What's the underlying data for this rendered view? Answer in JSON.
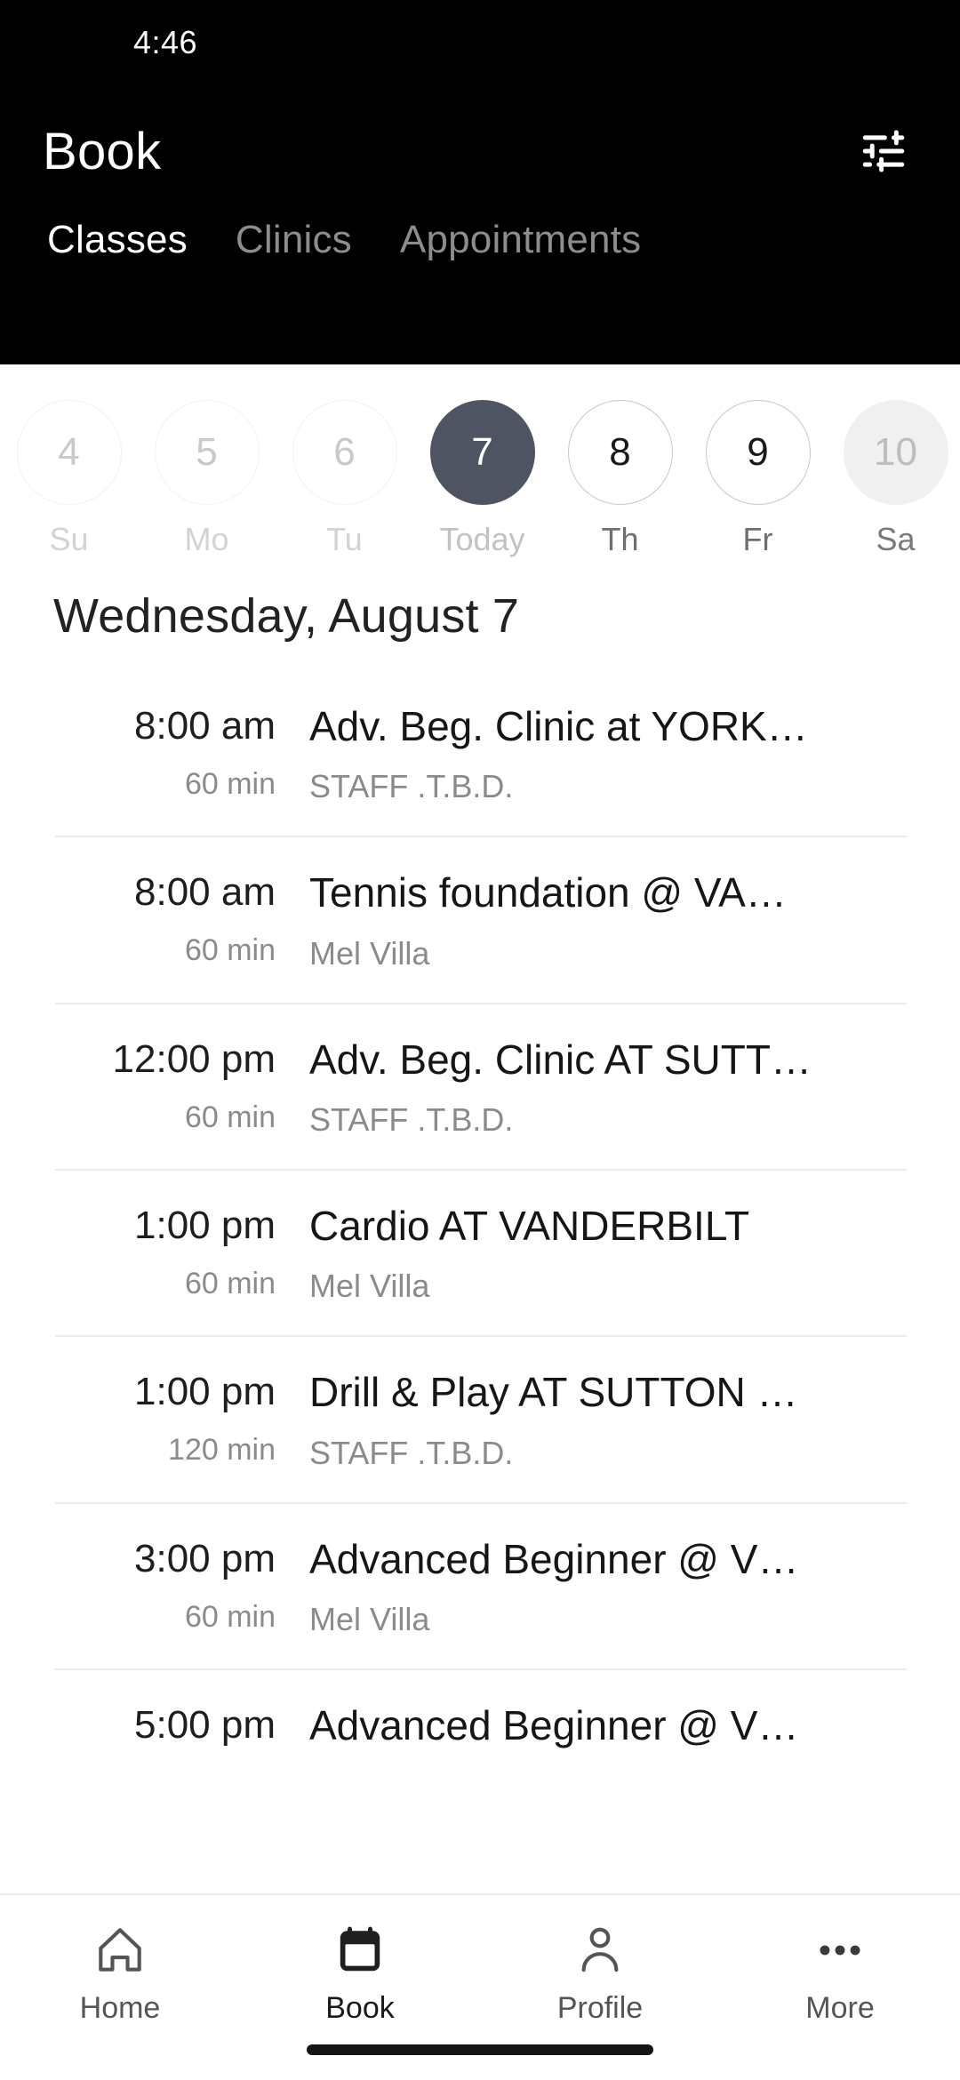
{
  "status_bar": {
    "time": "4:46"
  },
  "header": {
    "title": "Book",
    "filter_icon": "tune-icon",
    "tabs": [
      {
        "label": "Classes",
        "active": true
      },
      {
        "label": "Clinics",
        "active": false
      },
      {
        "label": "Appointments",
        "active": false
      }
    ]
  },
  "date_strip": {
    "days": [
      {
        "num": "4",
        "label": "Su",
        "state": "disabled"
      },
      {
        "num": "5",
        "label": "Mo",
        "state": "disabled"
      },
      {
        "num": "6",
        "label": "Tu",
        "state": "disabled"
      },
      {
        "num": "7",
        "label": "Today",
        "state": "selected"
      },
      {
        "num": "8",
        "label": "Th",
        "state": "enabled"
      },
      {
        "num": "9",
        "label": "Fr",
        "state": "enabled"
      },
      {
        "num": "10",
        "label": "Sa",
        "state": "filled"
      }
    ]
  },
  "schedule": {
    "heading": "Wednesday, August 7",
    "rows": [
      {
        "time": "8:00 am",
        "duration": "60 min",
        "title": "Adv. Beg. Clinic at YORK…",
        "instructor": "STAFF .T.B.D."
      },
      {
        "time": "8:00 am",
        "duration": "60 min",
        "title": "Tennis foundation @ VA…",
        "instructor": "Mel Villa"
      },
      {
        "time": "12:00 pm",
        "duration": "60 min",
        "title": "Adv. Beg. Clinic AT SUTT…",
        "instructor": "STAFF .T.B.D."
      },
      {
        "time": "1:00 pm",
        "duration": "60 min",
        "title": "Cardio AT VANDERBILT",
        "instructor": "Mel Villa"
      },
      {
        "time": "1:00 pm",
        "duration": "120 min",
        "title": "Drill & Play AT SUTTON …",
        "instructor": "STAFF .T.B.D."
      },
      {
        "time": "3:00 pm",
        "duration": "60 min",
        "title": "Advanced Beginner @ V…",
        "instructor": "Mel Villa"
      },
      {
        "time": "5:00 pm",
        "duration": "",
        "title": "Advanced Beginner @ V…",
        "instructor": ""
      }
    ]
  },
  "bottom_nav": {
    "items": [
      {
        "label": "Home",
        "icon": "home-icon",
        "active": false
      },
      {
        "label": "Book",
        "icon": "calendar-icon",
        "active": true
      },
      {
        "label": "Profile",
        "icon": "person-icon",
        "active": false
      },
      {
        "label": "More",
        "icon": "more-dots-icon",
        "active": false
      }
    ]
  },
  "colors": {
    "header_bg": "#000000",
    "selected_day": "#4f5462",
    "accent_text": "#1a1a1a",
    "muted_text": "#8b8b8b"
  }
}
